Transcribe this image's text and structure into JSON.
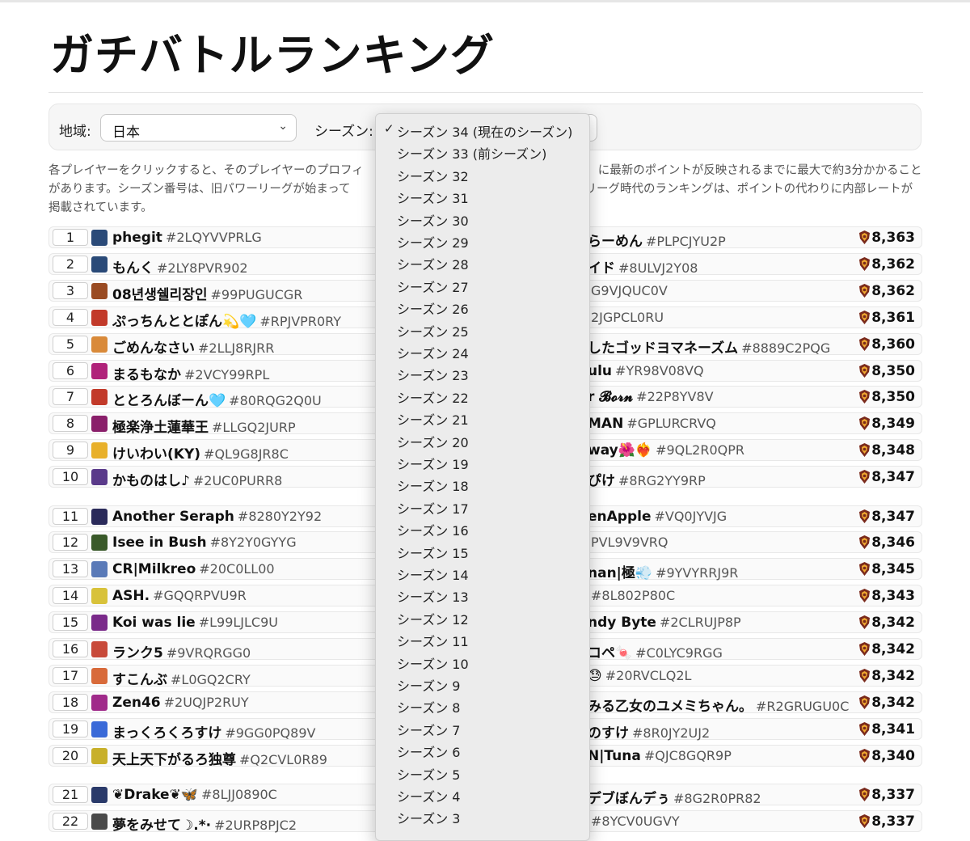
{
  "page": {
    "title": "ガチバトルランキング"
  },
  "filters": {
    "region_label": "地域:",
    "region_value": "日本",
    "season_label": "シーズン:"
  },
  "description": "各プレイヤーをクリックすると、そのプレイヤーのプロフィ　　　　　　　　　　　　　　　　　　　　に最新のポイントが反映されるまでに最大で約3分かかることがあります。シーズン番号は、旧パワーリーグが始まって　　　　　　　　　　　　　　　　　　　　リーグ時代のランキングは、ポイントの代わりに内部レートが掲載されています。",
  "colors": {
    "accent": "#f0a830",
    "trophy": "#7a2a1c"
  },
  "season_options": [
    "シーズン 34 (現在のシーズン)",
    "シーズン 33 (前シーズン)",
    "シーズン 32",
    "シーズン 31",
    "シーズン 30",
    "シーズン 29",
    "シーズン 28",
    "シーズン 27",
    "シーズン 26",
    "シーズン 25",
    "シーズン 24",
    "シーズン 23",
    "シーズン 22",
    "シーズン 21",
    "シーズン 20",
    "シーズン 19",
    "シーズン 18",
    "シーズン 17",
    "シーズン 16",
    "シーズン 15",
    "シーズン 14",
    "シーズン 13",
    "シーズン 12",
    "シーズン 11",
    "シーズン 10",
    "シーズン 9",
    "シーズン 8",
    "シーズン 7",
    "シーズン 6",
    "シーズン 5",
    "シーズン 4",
    "シーズン 3"
  ],
  "selected_season_index": 0,
  "left_rows": [
    {
      "rank": "1",
      "name": "phegit",
      "tag": "#2LQYVVPRLG",
      "avatar": "#2a4a78"
    },
    {
      "rank": "2",
      "name": "もんく",
      "tag": "#2LY8PVR902",
      "avatar": "#2a4a78"
    },
    {
      "rank": "3",
      "name": "08년생쉘리장인",
      "tag": "#99PUGUCGR",
      "avatar": "#9a4b22"
    },
    {
      "rank": "4",
      "name": "ぷっちんととぽん💫🩵",
      "tag": "#RPJVPR0RY",
      "avatar": "#c23a2a"
    },
    {
      "rank": "5",
      "name": "ごめんなさい",
      "tag": "#2LLJ8RJRR",
      "avatar": "#d98a3a"
    },
    {
      "rank": "6",
      "name": "まるもなか",
      "tag": "#2VCY99RPL",
      "avatar": "#b0227a"
    },
    {
      "rank": "7",
      "name": "ととろんぼーん🩵",
      "tag": "#80RQG2Q0U",
      "avatar": "#c23a2a"
    },
    {
      "rank": "8",
      "name": "極楽浄土蓮華王",
      "tag": "#LLGQ2JURP",
      "avatar": "#8a1f6a"
    },
    {
      "rank": "9",
      "name": "けいわい(KY)",
      "tag": "#QL9G8JR8C",
      "avatar": "#e8b02a"
    },
    {
      "rank": "10",
      "name": "かものはし♪",
      "tag": "#2UC0PURR8",
      "avatar": "#5a3a8a"
    },
    {
      "rank": "11",
      "name": "Another Seraph",
      "tag": "#8280Y2Y92",
      "avatar": "#2a2a5a"
    },
    {
      "rank": "12",
      "name": "Isee in Bush",
      "tag": "#8Y2Y0GYYG",
      "avatar": "#3a5a2a"
    },
    {
      "rank": "13",
      "name": "CR|Milkreo",
      "tag": "#20C0LL00",
      "avatar": "#5a7ab8"
    },
    {
      "rank": "14",
      "name": "ASH.",
      "tag": "#GQQRPVU9R",
      "avatar": "#d8c23a"
    },
    {
      "rank": "15",
      "name": "Koi was lie",
      "tag": "#L99LJLC9U",
      "avatar": "#7a2a8a"
    },
    {
      "rank": "16",
      "name": "ランク5",
      "tag": "#9VRQRGG0",
      "avatar": "#c84a3a"
    },
    {
      "rank": "17",
      "name": "すこんぶ",
      "tag": "#L0GQ2CRY",
      "avatar": "#d86a3a"
    },
    {
      "rank": "18",
      "name": "Zen46",
      "tag": "#2UQJP2RUY",
      "avatar": "#a02a8a"
    },
    {
      "rank": "19",
      "name": "まっくろくろすけ",
      "tag": "#9GG0PQ89V",
      "avatar": "#3a6ad8"
    },
    {
      "rank": "20",
      "name": "天上天下がるろ独尊",
      "tag": "#Q2CVL0R89",
      "avatar": "#c8b02a"
    },
    {
      "rank": "21",
      "name": "❦Drake❦🦋",
      "tag": "#8LJJ0890C",
      "avatar": "#2a3a6a"
    },
    {
      "rank": "22",
      "name": "夢をみせて☽.*·",
      "tag": "#2URP8PJC2",
      "avatar": "#4a4a4a"
    }
  ],
  "right_rows": [
    {
      "name": "らーめん",
      "tag": "#PLPCJYU2P",
      "points": "8,363"
    },
    {
      "name": "イド",
      "tag": "#8ULVJ2Y08",
      "points": "8,362"
    },
    {
      "name": "",
      "tag": "G9VJQUC0V",
      "points": "8,362"
    },
    {
      "name": "",
      "tag": "2JGPCL0RU",
      "points": "8,361"
    },
    {
      "name": "したゴッドヨマネーズム",
      "tag": "#8889C2PQG",
      "points": "8,360"
    },
    {
      "name": "ulu",
      "tag": "#YR98V08VQ",
      "points": "8,350"
    },
    {
      "name": "r 𝓑𝓸𝓻𝓷",
      "tag": "#22P8YV8V",
      "points": "8,350"
    },
    {
      "name": "MAN",
      "tag": "#GPLURCRVQ",
      "points": "8,349"
    },
    {
      "name": "way🌺❤️‍🔥",
      "tag": "#9QL2R0QPR",
      "points": "8,348"
    },
    {
      "name": "ぴけ",
      "tag": "#8RG2YY9RP",
      "points": "8,347"
    },
    {
      "name": "enApple",
      "tag": "#VQ0JYVJG",
      "points": "8,347"
    },
    {
      "name": "",
      "tag": "PVL9V9VRQ",
      "points": "8,346"
    },
    {
      "name": "nan|極💨",
      "tag": "#9YVYRRJ9R",
      "points": "8,345"
    },
    {
      "name": "",
      "tag": "#8L802P80C",
      "points": "8,343"
    },
    {
      "name": "ndy Byte",
      "tag": "#2CLRUJP8P",
      "points": "8,342"
    },
    {
      "name": "コペ🍬",
      "tag": "#C0LYC9RGG",
      "points": "8,342"
    },
    {
      "name": "😓",
      "tag": "#20RVCLQ2L",
      "points": "8,342"
    },
    {
      "name": "みる乙女のユメミちゃん。",
      "tag": "#R2GRUGU0C",
      "points": "8,342"
    },
    {
      "name": "のすけ",
      "tag": "#8R0JY2UJ2",
      "points": "8,341"
    },
    {
      "name": "N|Tuna",
      "tag": "#QJC8GQR9P",
      "points": "8,340"
    },
    {
      "name": "デブぼんデぅ",
      "tag": "#8G2R0PR82",
      "points": "8,337"
    },
    {
      "name": "",
      "tag": "#8YCV0UGVY",
      "points": "8,337"
    }
  ]
}
